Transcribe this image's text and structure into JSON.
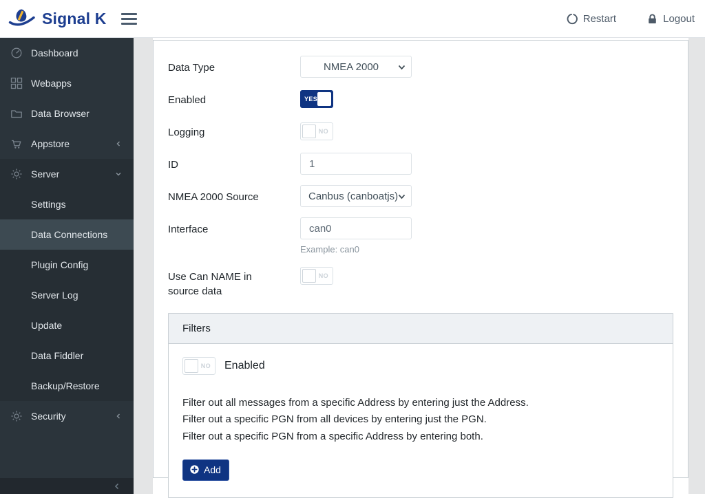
{
  "header": {
    "brand": "Signal K",
    "restart_label": "Restart",
    "logout_label": "Logout"
  },
  "sidebar": {
    "top_items": [
      {
        "label": "Dashboard",
        "icon": "speedometer-icon"
      },
      {
        "label": "Webapps",
        "icon": "grid-icon"
      },
      {
        "label": "Data Browser",
        "icon": "folder-icon"
      },
      {
        "label": "Appstore",
        "icon": "cart-icon",
        "chevron": "left"
      }
    ],
    "server_group": {
      "label": "Server",
      "icon": "gear-icon",
      "chevron": "down",
      "children": [
        "Settings",
        "Data Connections",
        "Plugin Config",
        "Server Log",
        "Update",
        "Data Fiddler",
        "Backup/Restore"
      ],
      "active_child": "Data Connections"
    },
    "security": {
      "label": "Security",
      "icon": "gear-icon",
      "chevron": "left"
    }
  },
  "form": {
    "data_type": {
      "label": "Data Type",
      "value": "NMEA 2000"
    },
    "enabled": {
      "label": "Enabled",
      "state": "YES"
    },
    "logging": {
      "label": "Logging",
      "state": "NO"
    },
    "id": {
      "label": "ID",
      "value": "1"
    },
    "nmea_source": {
      "label": "NMEA 2000 Source",
      "value": "Canbus (canboatjs)"
    },
    "interface": {
      "label": "Interface",
      "value": "can0",
      "hint": "Example: can0"
    },
    "use_can_name": {
      "label": "Use Can NAME in source data",
      "state": "NO"
    }
  },
  "filters": {
    "title": "Filters",
    "enabled": {
      "label": "Enabled",
      "state": "NO"
    },
    "description_lines": [
      "Filter out all messages from a specific Address by entering just the Address.",
      "Filter out a specific PGN from all devices by entering just the PGN.",
      "Filter out a specific PGN from a specific Address by entering both."
    ],
    "add_button": "Add"
  },
  "colors": {
    "primary": "#0f3482",
    "brand": "#1d3e90",
    "logo-yellow": "#f0b42f",
    "sidebar-bg": "#2b343b",
    "sidebar-group-bg": "#262e34",
    "sidebar-active-bg": "#3d4a52",
    "content-gray": "#e4e5e6",
    "card-border": "#c9cfd4",
    "panel-header-bg": "#eef1f4"
  }
}
